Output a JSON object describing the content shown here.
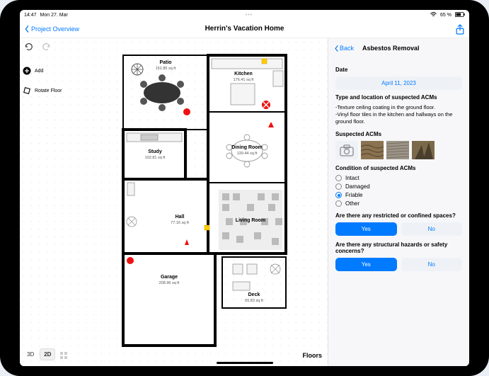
{
  "status": {
    "time": "14:47",
    "date": "Mon 27. Mar",
    "battery": "65 %"
  },
  "nav": {
    "back": "Project Overview",
    "title": "Herrin's Vacation Home"
  },
  "tools": {
    "add": "Add",
    "rotate": "Rotate Floor"
  },
  "view": {
    "three_d": "3D",
    "two_d": "2D"
  },
  "floors_label": "Floors",
  "rooms": {
    "patio": {
      "name": "Patio",
      "area": "152.85 sq ft"
    },
    "kitchen": {
      "name": "Kitchen",
      "area": "176.41 sq ft"
    },
    "study": {
      "name": "Study",
      "area": "102.81 sq ft"
    },
    "dining": {
      "name": "Dining Room",
      "area": "139.44 sq ft"
    },
    "hall": {
      "name": "Hall",
      "area": "77.16 sq ft"
    },
    "living": {
      "name": "Living Room",
      "area": ""
    },
    "garage": {
      "name": "Garage",
      "area": "208.96 sq ft"
    },
    "deck": {
      "name": "Deck",
      "area": "65.83 sq ft"
    }
  },
  "panel": {
    "back": "Back",
    "title": "Asbestos Removal",
    "date_label": "Date",
    "date_value": "April 11, 2023",
    "type_heading": "Type and location of suspected ACMs",
    "type_text": "-Texture ceiling coating in the ground floor.\n-Vinyl floor tiles in the kitchen and hallways on the ground floor.",
    "suspected_heading": "Suspected ACMs",
    "condition_heading": "Condition of suspected ACMs",
    "conditions": [
      "Intact",
      "Damaged",
      "Friable",
      "Other"
    ],
    "condition_selected": "Friable",
    "q1": "Are there any restricted or confined spaces?",
    "q2": "Are there any structural hazards or safety concerns?",
    "yes": "Yes",
    "no": "No"
  }
}
